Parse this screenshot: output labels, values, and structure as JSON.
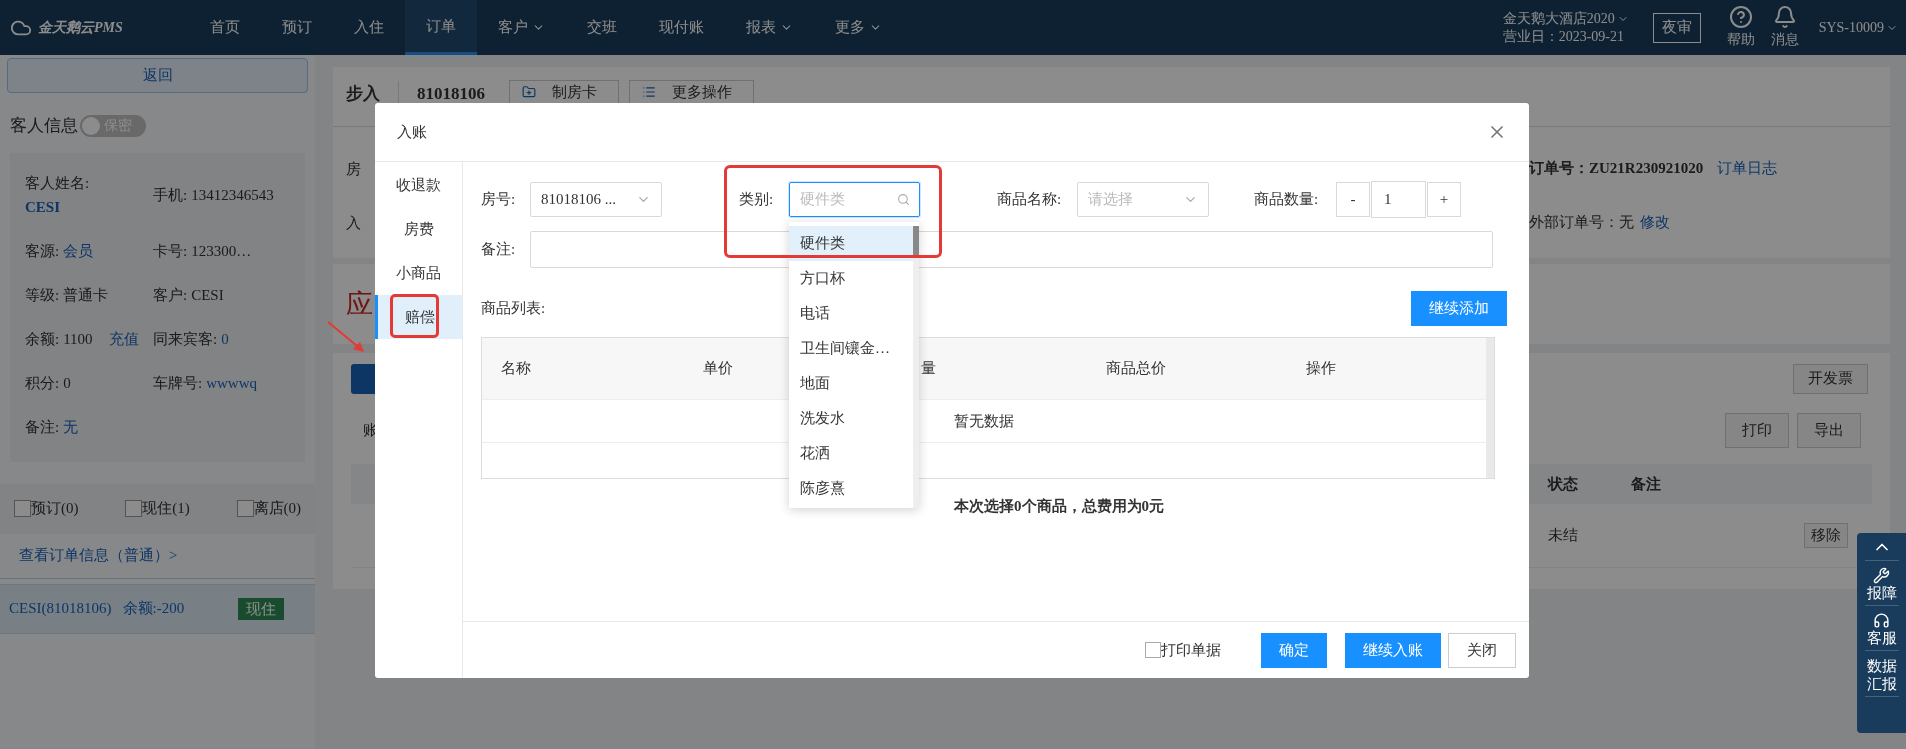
{
  "nav": {
    "logo": "金天鹅云PMS",
    "items": [
      {
        "label": "首页",
        "selected": false,
        "dropdown": false
      },
      {
        "label": "预订",
        "selected": false,
        "dropdown": false
      },
      {
        "label": "入住",
        "selected": false,
        "dropdown": false
      },
      {
        "label": "订单",
        "selected": true,
        "dropdown": false
      },
      {
        "label": "客户",
        "selected": false,
        "dropdown": true
      },
      {
        "label": "交班",
        "selected": false,
        "dropdown": false
      },
      {
        "label": "现付账",
        "selected": false,
        "dropdown": false
      },
      {
        "label": "报表",
        "selected": false,
        "dropdown": true
      },
      {
        "label": "更多",
        "selected": false,
        "dropdown": true
      }
    ],
    "hotel": "金天鹅大酒店2020",
    "business_date": "营业日：2023-09-21",
    "night_audit": "夜审",
    "help": "帮助",
    "messages": "消息",
    "user": "SYS-10009"
  },
  "sidebar": {
    "back": "返回",
    "guest_title": "客人信息",
    "privacy_toggle": {
      "label": "保密",
      "on": false
    },
    "fields": [
      {
        "label": "客人姓名:",
        "value": "CESI",
        "kind": "stacked",
        "link": true
      },
      {
        "label": "手机:",
        "value": "13412346543",
        "kind": "inline",
        "link": false
      },
      {
        "label": "客源:",
        "value": "会员",
        "kind": "inline",
        "link": true
      },
      {
        "label": "卡号:",
        "value": "123300…",
        "kind": "inline",
        "link": false
      },
      {
        "label": "等级:",
        "value": "普通卡",
        "kind": "inline",
        "link": false
      },
      {
        "label": "客户:",
        "value": "CESI",
        "kind": "inline",
        "link": false
      },
      {
        "label": "余额:",
        "value": "1100",
        "kind": "inline",
        "link": false,
        "action": "充值"
      },
      {
        "label": "同来宾客:",
        "value": "0",
        "kind": "inline",
        "link": true
      },
      {
        "label": "积分:",
        "value": "0",
        "kind": "inline",
        "link": false
      },
      {
        "label": "车牌号:",
        "value": "wwwwq",
        "kind": "inline",
        "link": true
      },
      {
        "label": "备注:",
        "value": "无",
        "kind": "inline",
        "link": true
      }
    ],
    "filters": [
      {
        "label": "预订(0)",
        "checked": false
      },
      {
        "label": "现住(1)",
        "checked": false
      },
      {
        "label": "离店(0)",
        "checked": false
      }
    ],
    "order_info_link": "查看订单信息（普通）>",
    "rooms": [
      {
        "name": "CESI(81018106)",
        "balance": "余额:-200",
        "status": "现住",
        "selected": true
      }
    ]
  },
  "order": {
    "status": "步入",
    "room": "81018106",
    "buttons": [
      {
        "label": "制房卡",
        "kind": "folder"
      },
      {
        "label": "更多操作",
        "kind": "list"
      }
    ],
    "fragments": [
      "房",
      "入"
    ],
    "order_no_label": "订单号：",
    "order_no": "ZU21R230921020",
    "log_link": "订单日志",
    "ext_label": "外部订单号：",
    "ext_value": "无",
    "edit_link": "修改",
    "amount_fragment": "应",
    "bill_fragment": "账",
    "invoice": "开发票",
    "print": "打印",
    "export": "导出",
    "columns": [
      "状态",
      "备注"
    ],
    "rows": [
      {
        "status": "未结",
        "action": "移除"
      }
    ]
  },
  "float_toolbar": [
    {
      "kind": "top"
    },
    {
      "kind": "repair",
      "label": "报障"
    },
    {
      "kind": "service",
      "label": "客服"
    },
    {
      "kind": "report",
      "label": "数据汇报"
    }
  ],
  "annotation_arrow": true,
  "modal": {
    "title": "入账",
    "tabs": [
      {
        "label": "收退款",
        "selected": false,
        "annotated": false
      },
      {
        "label": "房费",
        "selected": false,
        "annotated": false
      },
      {
        "label": "小商品",
        "selected": false,
        "annotated": false
      },
      {
        "label": "赔偿",
        "selected": true,
        "annotated": true
      }
    ],
    "room": {
      "label": "房号:",
      "value": "81018106 ..."
    },
    "category": {
      "label": "类别:",
      "placeholder": "硬件类",
      "focused": true,
      "annotated": true
    },
    "product": {
      "label": "商品名称:",
      "placeholder": "请选择"
    },
    "quantity": {
      "label": "商品数量:",
      "minus": "-",
      "value": "1",
      "plus": "+"
    },
    "note": {
      "label": "备注:"
    },
    "list_label": "商品列表:",
    "add_button": "继续添加",
    "columns": [
      "名称",
      "单价",
      "量",
      "商品总价",
      "操作"
    ],
    "empty": "暂无数据",
    "summary": "本次选择0个商品，总费用为0元",
    "dropdown": [
      {
        "label": "硬件类",
        "selected": true
      },
      {
        "label": "方口杯",
        "selected": false
      },
      {
        "label": "电话",
        "selected": false
      },
      {
        "label": "卫生间镶金…",
        "selected": false
      },
      {
        "label": "地面",
        "selected": false
      },
      {
        "label": "洗发水",
        "selected": false
      },
      {
        "label": "花洒",
        "selected": false
      },
      {
        "label": "陈彦熹",
        "selected": false
      }
    ],
    "print_receipt": {
      "label": "打印单据",
      "checked": false
    },
    "buttons": [
      {
        "label": "确定",
        "kind": "primary"
      },
      {
        "label": "继续入账",
        "kind": "primary"
      },
      {
        "label": "关闭",
        "kind": "default"
      }
    ]
  }
}
